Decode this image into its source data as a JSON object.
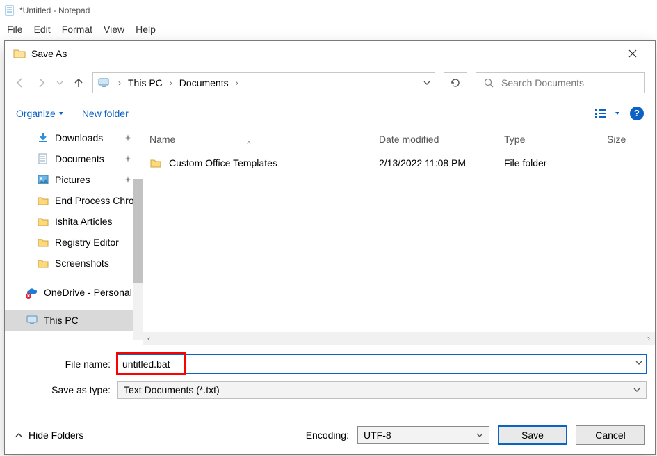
{
  "notepad": {
    "title": "*Untitled - Notepad",
    "menu": {
      "file": "File",
      "edit": "Edit",
      "format": "Format",
      "view": "View",
      "help": "Help"
    }
  },
  "dialog": {
    "title": "Save As",
    "breadcrumb": {
      "root": "This PC",
      "folder": "Documents"
    },
    "search_placeholder": "Search Documents",
    "organize": "Organize",
    "new_folder": "New folder",
    "columns": {
      "name": "Name",
      "date": "Date modified",
      "type": "Type",
      "size": "Size"
    },
    "rows": [
      {
        "name": "Custom Office Templates",
        "date": "2/13/2022 11:08 PM",
        "type": "File folder",
        "size": ""
      }
    ],
    "sidebar": [
      {
        "label": "Downloads",
        "icon": "download",
        "pinned": true
      },
      {
        "label": "Documents",
        "icon": "document",
        "pinned": true
      },
      {
        "label": "Pictures",
        "icon": "pictures",
        "pinned": true
      },
      {
        "label": "End Process Chrom",
        "icon": "folder"
      },
      {
        "label": "Ishita Articles",
        "icon": "folder"
      },
      {
        "label": "Registry Editor",
        "icon": "folder"
      },
      {
        "label": "Screenshots",
        "icon": "folder"
      },
      {
        "label": "OneDrive - Personal",
        "icon": "onedrive",
        "level": 2,
        "error": true
      },
      {
        "label": "This PC",
        "icon": "thispc",
        "level": 2,
        "selected": true
      }
    ],
    "file_name_label": "File name:",
    "file_name_value": "untitled.bat",
    "save_type_label": "Save as type:",
    "save_type_value": "Text Documents (*.txt)",
    "hide_folders": "Hide Folders",
    "encoding_label": "Encoding:",
    "encoding_value": "UTF-8",
    "save_btn": "Save",
    "cancel_btn": "Cancel",
    "help_badge": "?"
  }
}
